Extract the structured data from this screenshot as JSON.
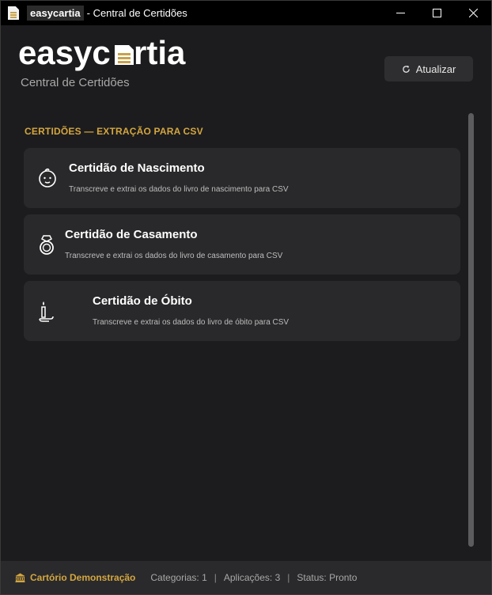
{
  "window": {
    "app_name": "easycartia",
    "title_suffix": "- Central de Certidões"
  },
  "header": {
    "logo_text_left": "easyc",
    "logo_text_right": "rtia",
    "subtitle": "Central de Certidões",
    "refresh_label": "Atualizar"
  },
  "section": {
    "title": "CERTIDÕES — EXTRAÇÃO PARA CSV"
  },
  "cards": [
    {
      "title": "Certidão de Nascimento",
      "description": "Transcreve e extrai os dados do livro de nascimento para CSV",
      "icon": "baby-face-icon"
    },
    {
      "title": "Certidão de Casamento",
      "description": "Transcreve e extrai os dados do livro de casamento para CSV",
      "icon": "ring-icon"
    },
    {
      "title": "Certidão de Óbito",
      "description": "Transcreve e extrai os dados do livro de óbito para CSV",
      "icon": "candle-icon"
    }
  ],
  "statusbar": {
    "org": "Cartório Demonstração",
    "categories": "Categorias: 1",
    "applications": "Aplicações: 3",
    "status": "Status: Pronto",
    "separator": "|"
  },
  "colors": {
    "accent": "#d4a63f",
    "background": "#1c1c1e",
    "card": "#29292b"
  }
}
